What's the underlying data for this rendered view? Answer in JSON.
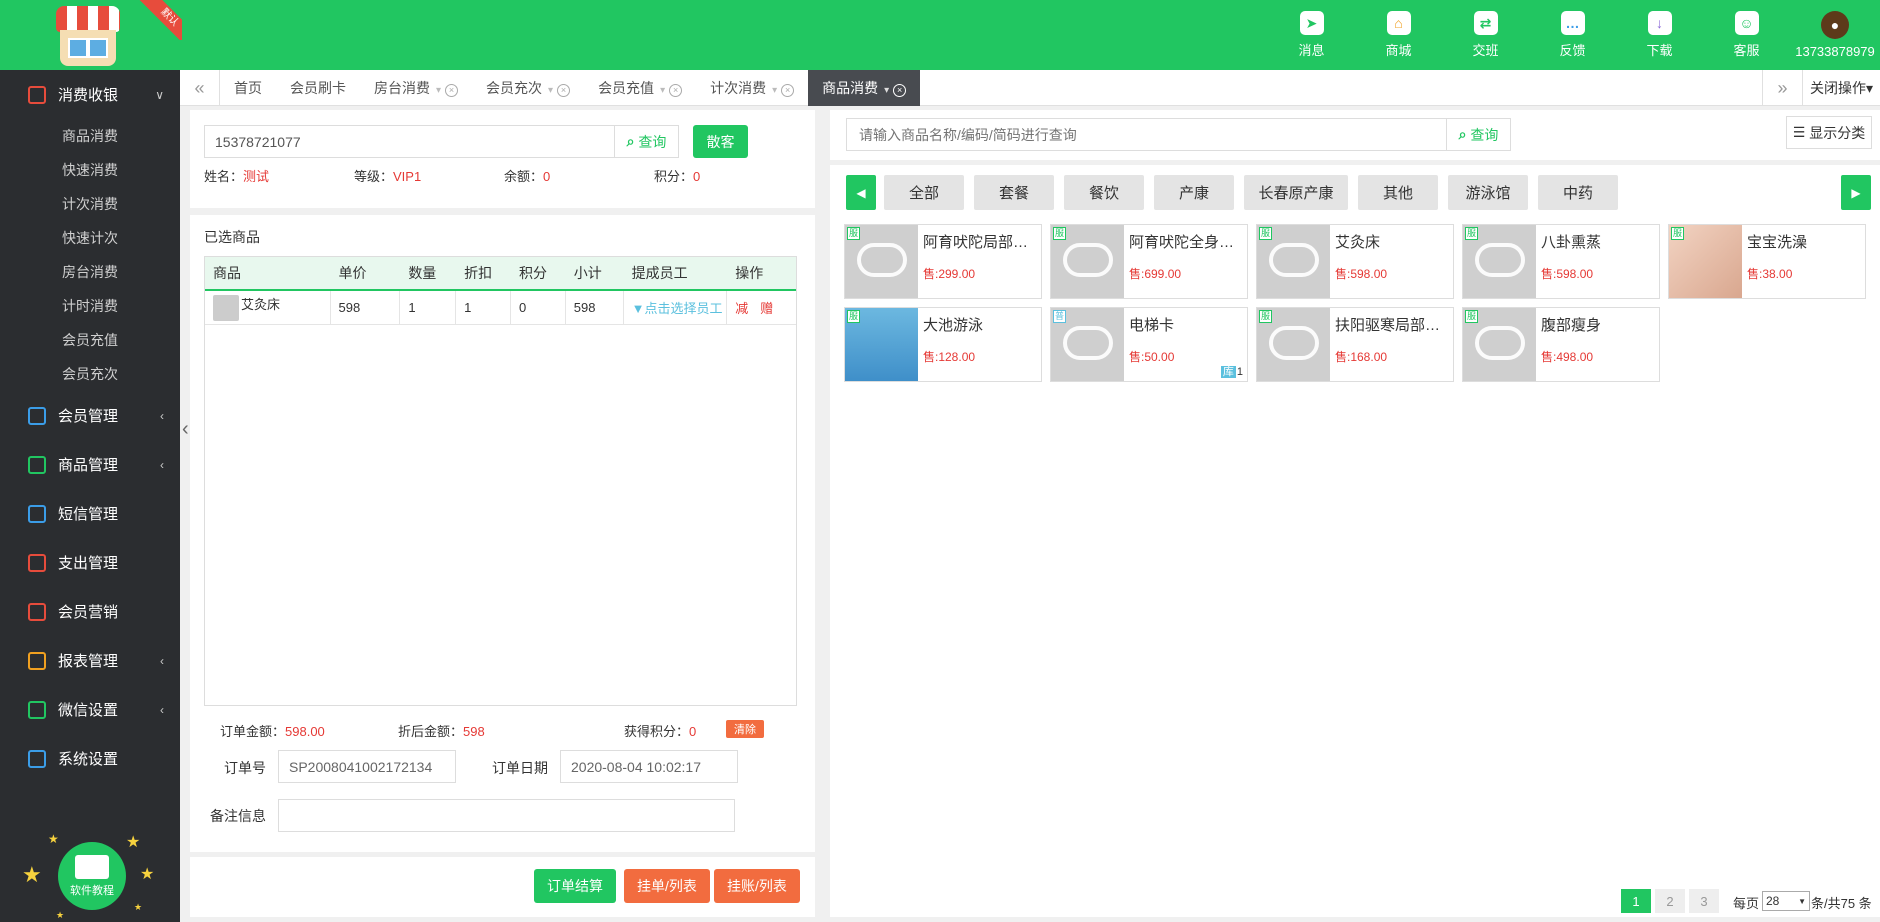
{
  "brand": {
    "badge": "默认",
    "colors": {
      "primary": "#21c661",
      "sidebar": "#2b2d30",
      "danger": "#e53935",
      "orange": "#f26c3f"
    }
  },
  "topnav": [
    {
      "label": "消息",
      "icon": "paper-plane-icon",
      "glyph": "➤",
      "color": "#21c661"
    },
    {
      "label": "商城",
      "icon": "store-icon",
      "glyph": "⌂",
      "color": "#f0a020"
    },
    {
      "label": "交班",
      "icon": "shift-swap-icon",
      "glyph": "⇄",
      "color": "#21c661"
    },
    {
      "label": "反馈",
      "icon": "feedback-icon",
      "glyph": "…",
      "color": "#3b9de8"
    },
    {
      "label": "下载",
      "icon": "download-icon",
      "glyph": "↓",
      "color": "#8e6bd8"
    },
    {
      "label": "客服",
      "icon": "customer-service-icon",
      "glyph": "☺",
      "color": "#21c661"
    }
  ],
  "user": {
    "phone": "13733878979",
    "icon": "avatar-icon"
  },
  "sidebar": {
    "groups": [
      {
        "label": "消费收银",
        "icon": "cashier-icon",
        "color": "#e74c3c",
        "arrow": "∨",
        "expanded": true,
        "items": [
          "商品消费",
          "快速消费",
          "计次消费",
          "快速计次",
          "房台消费",
          "计时消费",
          "会员充值",
          "会员充次"
        ]
      },
      {
        "label": "会员管理",
        "icon": "member-icon",
        "color": "#3b9de8",
        "arrow": "‹"
      },
      {
        "label": "商品管理",
        "icon": "goods-icon",
        "color": "#21c661",
        "arrow": "‹"
      },
      {
        "label": "短信管理",
        "icon": "sms-icon",
        "color": "#3b9de8",
        "arrow": ""
      },
      {
        "label": "支出管理",
        "icon": "expense-icon",
        "color": "#e74c3c",
        "arrow": ""
      },
      {
        "label": "会员营销",
        "icon": "gift-icon",
        "color": "#e74c3c",
        "arrow": ""
      },
      {
        "label": "报表管理",
        "icon": "report-icon",
        "color": "#f0a020",
        "arrow": "‹"
      },
      {
        "label": "微信设置",
        "icon": "wechat-icon",
        "color": "#21c661",
        "arrow": "‹"
      },
      {
        "label": "系统设置",
        "icon": "settings-icon",
        "color": "#3b9de8",
        "arrow": ""
      }
    ],
    "tutorial": "软件教程"
  },
  "tabs": {
    "prev": "«",
    "next": "»",
    "items": [
      {
        "label": "首页",
        "pin": false,
        "close": false,
        "active": false
      },
      {
        "label": "会员刷卡",
        "pin": false,
        "close": false,
        "active": false
      },
      {
        "label": "房台消费",
        "pin": true,
        "close": true,
        "active": false
      },
      {
        "label": "会员充次",
        "pin": true,
        "close": true,
        "active": false
      },
      {
        "label": "会员充值",
        "pin": true,
        "close": true,
        "active": false
      },
      {
        "label": "计次消费",
        "pin": true,
        "close": true,
        "active": false
      },
      {
        "label": "商品消费",
        "pin": true,
        "close": true,
        "active": true
      }
    ],
    "close_ops": "关闭操作▾"
  },
  "member": {
    "card_value": "15378721077",
    "query_label": "查询",
    "scatter_label": "散客",
    "fields": [
      {
        "label": "姓名：",
        "value": "测试"
      },
      {
        "label": "等级：",
        "value": "VIP1"
      },
      {
        "label": "余额：",
        "value": "0"
      },
      {
        "label": "积分：",
        "value": "0"
      }
    ]
  },
  "selected": {
    "title": "已选商品",
    "headers": [
      "商品",
      "单价",
      "数量",
      "折扣",
      "积分",
      "小计",
      "提成员工",
      "操作"
    ],
    "rows": [
      {
        "name": "艾灸床",
        "price": "598",
        "qty": "1",
        "discount": "1",
        "points": "0",
        "subtotal": "598",
        "staff": "▼点击选择员工",
        "op_reduce": "减",
        "op_gift": "赠"
      }
    ]
  },
  "summary": {
    "order_amount_label": "订单金额：",
    "order_amount": "598.00",
    "discount_amount_label": "折后金额：",
    "discount_amount": "598",
    "earned_points_label": "获得积分：",
    "earned_points": "0",
    "clear_label": "清除",
    "order_no_label": "订单号",
    "order_no": "SP2008041002172134",
    "order_date_label": "订单日期",
    "order_date": "2020-08-04 10:02:17",
    "remark_label": "备注信息",
    "remark": ""
  },
  "actions": {
    "checkout": "订单结算",
    "hold_list": "挂单/列表",
    "credit_list": "挂账/列表"
  },
  "search": {
    "placeholder": "请输入商品名称/编码/简码进行查询",
    "button": "查询",
    "show_category": "显示分类"
  },
  "categories": [
    "全部",
    "套餐",
    "餐饮",
    "产康",
    "长春原产康",
    "其他",
    "游泳馆",
    "中药"
  ],
  "products": [
    {
      "name": "阿育吠陀局部…",
      "price": "售:299.00",
      "tag": "服",
      "photo": ""
    },
    {
      "name": "阿育吠陀全身…",
      "price": "售:699.00",
      "tag": "服",
      "photo": ""
    },
    {
      "name": "艾灸床",
      "price": "售:598.00",
      "tag": "服",
      "photo": ""
    },
    {
      "name": "八卦熏蒸",
      "price": "售:598.00",
      "tag": "服",
      "photo": ""
    },
    {
      "name": "宝宝洗澡",
      "price": "售:38.00",
      "tag": "服",
      "photo": "baby"
    },
    {
      "name": "大池游泳",
      "price": "售:128.00",
      "tag": "服",
      "photo": "pool"
    },
    {
      "name": "电梯卡",
      "price": "售:50.00",
      "tag": "普",
      "photo": "",
      "stock_label": "库",
      "stock": "1"
    },
    {
      "name": "扶阳驱寒局部…",
      "price": "售:168.00",
      "tag": "服",
      "photo": ""
    },
    {
      "name": "腹部瘦身",
      "price": "售:498.00",
      "tag": "服",
      "photo": ""
    }
  ],
  "pager": {
    "pages": [
      "1",
      "2",
      "3"
    ],
    "current": "1",
    "per_page_label": "每页",
    "per_page": "28",
    "total_text": "条/共75 条"
  }
}
